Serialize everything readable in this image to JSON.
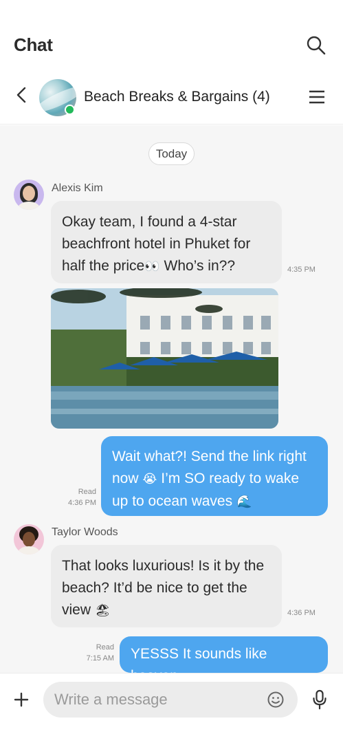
{
  "app": {
    "title": "Chat"
  },
  "chat": {
    "group_name": "Beach Breaks & Bargains (4)"
  },
  "date_divider": "Today",
  "messages": [
    {
      "sender": "Alexis Kim",
      "text": "Okay team, I found a 4-star beachfront hotel in Phuket for half the price",
      "emoji": "👀",
      "text_after": " Who’s in??",
      "time": "4:35 PM"
    },
    {
      "text": "Wait what?! Send the link right now",
      "emoji": "😭",
      "text_after": " I’m SO ready to wake up to ocean waves",
      "emoji_end": "🌊",
      "status": "Read",
      "time": "4:36 PM"
    },
    {
      "sender": "Taylor Woods",
      "text": "That looks luxurious! Is it by the beach? It’d be nice to get the view",
      "emoji": "🏖",
      "time": "4:36 PM"
    },
    {
      "text": "YESSS It sounds like heaven",
      "status": "Read",
      "time": "7:15 AM"
    }
  ],
  "composer": {
    "placeholder": "Write a message"
  },
  "colors": {
    "outgoing": "#4ea6ef",
    "incoming": "#ececec",
    "online": "#22b95a"
  }
}
